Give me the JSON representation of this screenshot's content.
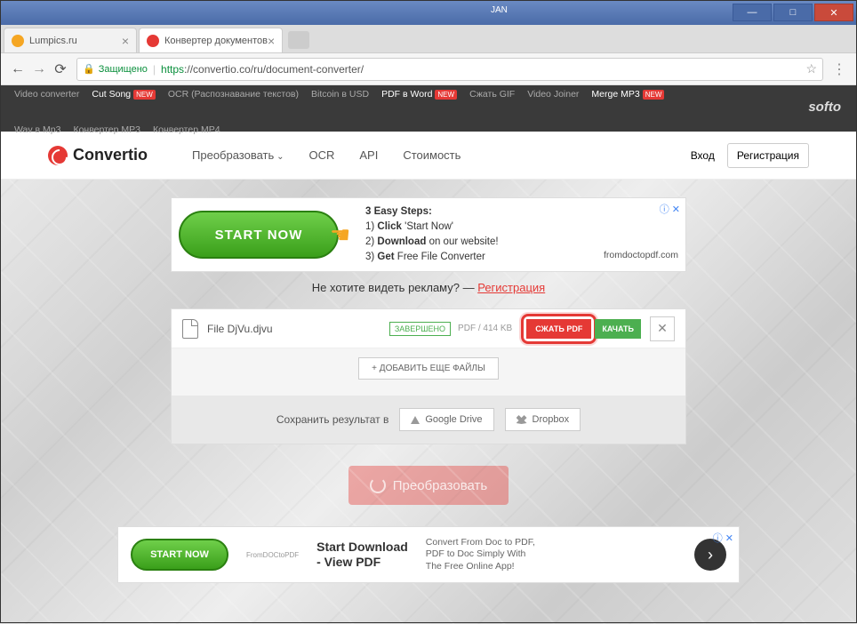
{
  "window": {
    "label": "JAN"
  },
  "tabs": [
    {
      "title": "Lumpics.ru"
    },
    {
      "title": "Конвертер документов"
    }
  ],
  "addressBar": {
    "secure": "Защищено",
    "https": "https",
    "url": "://convertio.co/ru/document-converter/"
  },
  "toolbar": {
    "links": [
      "Video converter",
      "Cut Song",
      "OCR (Распознавание текстов)",
      "Bitcoin в USD",
      "PDF в Word",
      "Сжать GIF",
      "Video Joiner",
      "Merge MP3",
      "Wav в Mp3",
      "Конвертер MP3",
      "Конвертер MP4"
    ],
    "new": "NEW",
    "brand": "softo"
  },
  "header": {
    "logo": "Convertio",
    "nav": {
      "convert": "Преобразовать",
      "ocr": "OCR",
      "api": "API",
      "pricing": "Стоимость"
    },
    "auth": {
      "login": "Вход",
      "register": "Регистрация"
    }
  },
  "ad1": {
    "button": "START NOW",
    "title": "3 Easy Steps:",
    "l1a": "1) ",
    "l1b": "Click",
    "l1c": " 'Start Now'",
    "l2a": "2) ",
    "l2b": "Download",
    "l2c": " on our website!",
    "l3a": "3) ",
    "l3b": "Get",
    "l3c": " Free File Converter",
    "domain": "fromdoctopdf.com"
  },
  "noAds": {
    "text": "Не хотите видеть рекламу? — ",
    "link": "Регистрация"
  },
  "file": {
    "name": "File DjVu.djvu",
    "status": "ЗАВЕРШЕНО",
    "meta": "PDF / 414 KB",
    "compress": "СЖАТЬ PDF",
    "download": "КАЧАТЬ"
  },
  "addMore": "ДОБАВИТЬ ЕЩЕ ФАЙЛЫ",
  "saveTo": {
    "label": "Сохранить результат в",
    "gdrive": "Google Drive",
    "dropbox": "Dropbox"
  },
  "convert": "Преобразовать",
  "ad2": {
    "button": "START NOW",
    "logo": "FromDOCtoPDF",
    "title1": "Start Download",
    "title2": "- View PDF",
    "desc1": "Convert From Doc to PDF,",
    "desc2": "PDF to Doc Simply With",
    "desc3": "The Free Online App!"
  }
}
